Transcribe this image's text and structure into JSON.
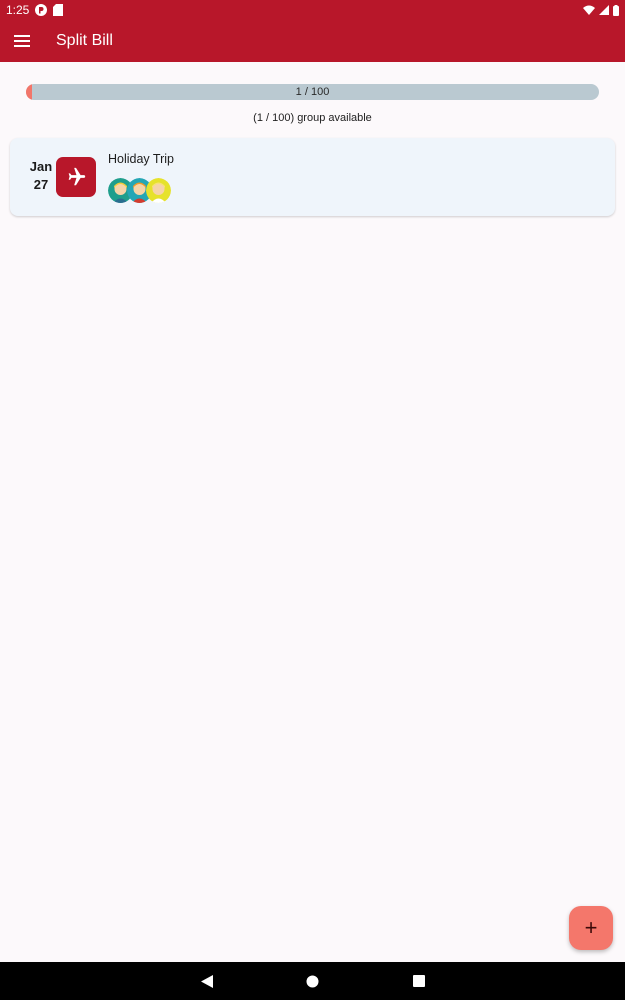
{
  "status_bar": {
    "time": "1:25",
    "left_icons": [
      "pocket-casts-icon",
      "sd-card-icon"
    ],
    "right_icons": [
      "wifi-icon",
      "signal-icon",
      "battery-icon"
    ]
  },
  "app_bar": {
    "title": "Split Bill",
    "menu_icon": "hamburger-menu-icon",
    "color": "#b8172a"
  },
  "usage": {
    "progress_label": "1 / 100",
    "progress_value": 0.01,
    "available_text": "(1 / 100) group available"
  },
  "groups": [
    {
      "month": "Jan",
      "day": "27",
      "title": "Holiday Trip",
      "category_icon": "airplane-icon",
      "member_count": 3
    }
  ],
  "fab": {
    "label": "+",
    "icon": "add-icon",
    "color": "#f4776b"
  },
  "nav_bar": [
    "back-icon",
    "home-icon",
    "recents-icon"
  ]
}
